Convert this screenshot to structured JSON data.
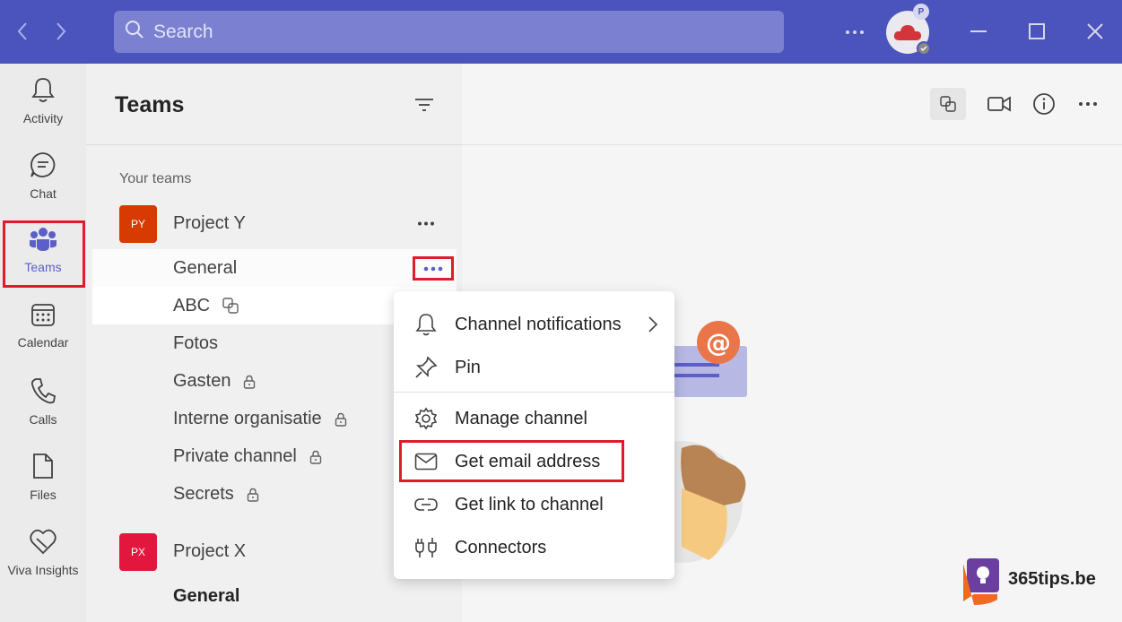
{
  "titlebar": {
    "search_placeholder": "Search",
    "presence_badge": "P"
  },
  "rail": {
    "items": [
      {
        "label": "Activity",
        "icon": "bell-icon"
      },
      {
        "label": "Chat",
        "icon": "chat-icon"
      },
      {
        "label": "Teams",
        "icon": "teams-icon",
        "active": true
      },
      {
        "label": "Calendar",
        "icon": "calendar-icon"
      },
      {
        "label": "Calls",
        "icon": "phone-icon"
      },
      {
        "label": "Files",
        "icon": "file-icon"
      },
      {
        "label": "Viva Insights",
        "icon": "viva-insights-icon"
      }
    ]
  },
  "panel": {
    "title": "Teams",
    "section_label": "Your teams",
    "teams": [
      {
        "initials": "PY",
        "name": "Project Y",
        "color": "#d83b01",
        "channels": [
          "General",
          "ABC",
          "Fotos",
          "Gasten",
          "Interne organisatie",
          "Private channel",
          "Secrets"
        ]
      },
      {
        "initials": "PX",
        "name": "Project X",
        "color": "#e3163e",
        "channels": [
          "General"
        ]
      }
    ]
  },
  "menu": {
    "items": [
      {
        "label": "Channel notifications",
        "icon": "bell-icon"
      },
      {
        "label": "Pin",
        "icon": "pin-icon"
      },
      {
        "label": "Manage channel",
        "icon": "gear-icon"
      },
      {
        "label": "Get email address",
        "icon": "mail-icon"
      },
      {
        "label": "Get link to channel",
        "icon": "link-icon"
      },
      {
        "label": "Connectors",
        "icon": "connectors-icon"
      }
    ]
  },
  "watermark": {
    "text": "365tips.be"
  },
  "colors": {
    "brand": "#4b53bc",
    "highlight": "#e01c2c",
    "accent": "#5b5fc7"
  }
}
